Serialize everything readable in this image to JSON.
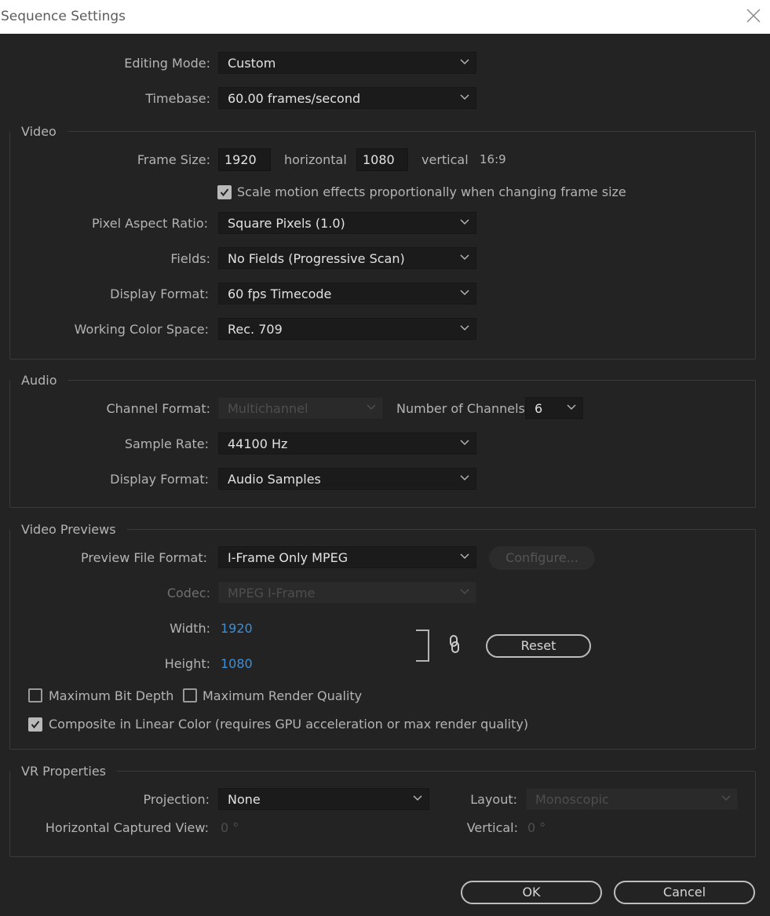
{
  "window": {
    "title": "Sequence Settings"
  },
  "general": {
    "editing_mode_label": "Editing Mode:",
    "editing_mode_value": "Custom",
    "timebase_label": "Timebase:",
    "timebase_value": "60.00  frames/second"
  },
  "video": {
    "group_title": "Video",
    "frame_size_label": "Frame Size:",
    "frame_width": "1920",
    "horizontal_label": "horizontal",
    "frame_height": "1080",
    "vertical_label": "vertical",
    "aspect": "16:9",
    "scale_checkbox_label": "Scale motion effects proportionally when changing frame size",
    "scale_checked": true,
    "par_label": "Pixel Aspect Ratio:",
    "par_value": "Square Pixels (1.0)",
    "fields_label": "Fields:",
    "fields_value": "No Fields (Progressive Scan)",
    "display_format_label": "Display Format:",
    "display_format_value": "60 fps Timecode",
    "color_space_label": "Working Color Space:",
    "color_space_value": "Rec. 709"
  },
  "audio": {
    "group_title": "Audio",
    "channel_format_label": "Channel Format:",
    "channel_format_value": "Multichannel",
    "num_channels_label": "Number of Channels:",
    "num_channels_value": "6",
    "sample_rate_label": "Sample Rate:",
    "sample_rate_value": "44100 Hz",
    "display_format_label": "Display Format:",
    "display_format_value": "Audio Samples"
  },
  "previews": {
    "group_title": "Video Previews",
    "file_format_label": "Preview File Format:",
    "file_format_value": "I-Frame Only MPEG",
    "configure_label": "Configure...",
    "codec_label": "Codec:",
    "codec_value": "MPEG I-Frame",
    "width_label": "Width:",
    "width_value": "1920",
    "height_label": "Height:",
    "height_value": "1080",
    "reset_label": "Reset",
    "max_bit_depth_label": "Maximum Bit Depth",
    "max_bit_depth_checked": false,
    "max_render_quality_label": "Maximum Render Quality",
    "max_render_quality_checked": false,
    "composite_linear_label": "Composite in Linear Color (requires GPU acceleration or max render quality)",
    "composite_linear_checked": true
  },
  "vr": {
    "group_title": "VR Properties",
    "projection_label": "Projection:",
    "projection_value": "None",
    "layout_label": "Layout:",
    "layout_value": "Monoscopic",
    "h_view_label": "Horizontal Captured View:",
    "h_view_value": "0 °",
    "vertical_label": "Vertical:",
    "vertical_value": "0 °"
  },
  "buttons": {
    "ok": "OK",
    "cancel": "Cancel"
  },
  "colors": {
    "background": "#232323",
    "link": "#3b8fd9",
    "titlebar": "#ffffff"
  }
}
